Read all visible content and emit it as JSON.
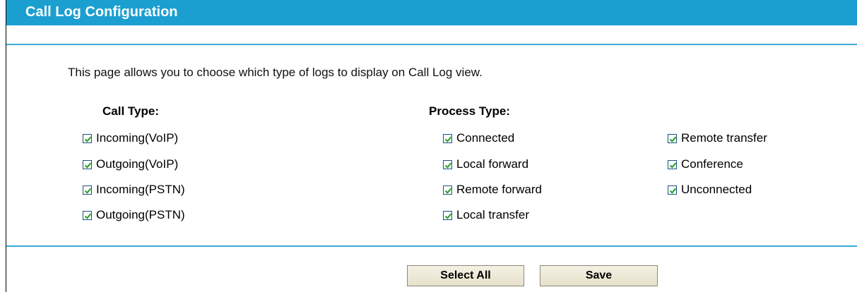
{
  "header": {
    "title": "Call Log Configuration"
  },
  "description": "This page allows you to choose which type of logs to display on Call Log view.",
  "call_type": {
    "title": "Call Type:",
    "items": [
      {
        "label": "Incoming(VoIP)",
        "checked": true
      },
      {
        "label": "Outgoing(VoIP)",
        "checked": true
      },
      {
        "label": "Incoming(PSTN)",
        "checked": true
      },
      {
        "label": "Outgoing(PSTN)",
        "checked": true
      }
    ]
  },
  "process_type": {
    "title": "Process Type:",
    "col1": [
      {
        "label": "Connected",
        "checked": true
      },
      {
        "label": "Local forward",
        "checked": true
      },
      {
        "label": "Remote forward",
        "checked": true
      },
      {
        "label": "Local transfer",
        "checked": true
      }
    ],
    "col2": [
      {
        "label": "Remote transfer",
        "checked": true
      },
      {
        "label": "Conference",
        "checked": true
      },
      {
        "label": "Unconnected",
        "checked": true
      }
    ]
  },
  "buttons": {
    "select_all": "Select All",
    "save": "Save"
  },
  "colors": {
    "accent": "#1b9fd1",
    "check": "#21a121",
    "checkbox_border": "#1c5180"
  }
}
